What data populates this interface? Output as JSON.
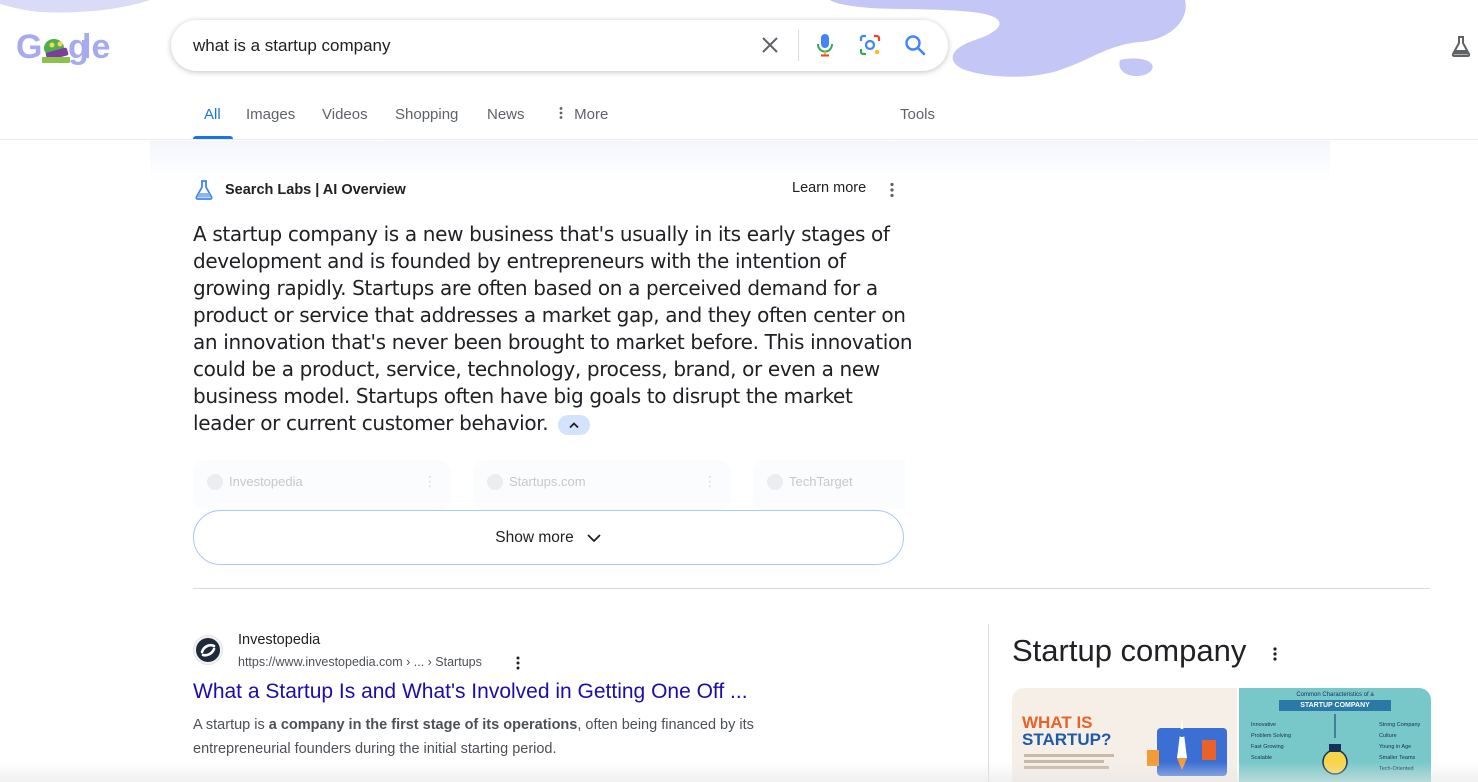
{
  "logo": {
    "text": "Google",
    "icon": "google-doodle-logo"
  },
  "search": {
    "query": "what is a startup company",
    "clear_icon": "close-icon",
    "voice_icon": "microphone-icon",
    "lens_icon": "camera-lens-icon",
    "search_icon": "search-icon"
  },
  "header": {
    "labs_icon": "flask-icon"
  },
  "nav": {
    "tabs": [
      {
        "label": "All",
        "active": true
      },
      {
        "label": "Images"
      },
      {
        "label": "Videos"
      },
      {
        "label": "Shopping"
      },
      {
        "label": "News"
      },
      {
        "label": "More"
      }
    ],
    "tools": "Tools"
  },
  "ai_overview": {
    "title": "Search Labs | AI Overview",
    "learn_more": "Learn more",
    "text": "A startup company is a new business that's usually in its early stages of development and is founded by entrepreneurs with the intention of growing rapidly. Startups are often based on a perceived demand for a product or service that addresses a market gap, and they often center on an innovation that's never been brought to market before. This innovation could be a product, service, technology, process, brand, or even a new business model. Startups often have big goals to disrupt the market leader or current customer behavior.",
    "sources": [
      "Investopedia",
      "Startups.com",
      "TechTarget"
    ],
    "show_more": "Show more"
  },
  "result": {
    "site_name": "Investopedia",
    "url": "https://www.investopedia.com › ... › Startups",
    "title": "What a Startup Is and What's Involved in Getting One Off ...",
    "snippet_pre": "A startup is ",
    "snippet_bold": "a company in the first stage of its operations",
    "snippet_post": ", often being financed by its entrepreneurial founders during the initial starting period."
  },
  "knowledge_panel": {
    "title": "Startup company",
    "image1_title_line1": "WHAT IS",
    "image1_title_line2": "STARTUP?",
    "image2_heading": "Common Characteristics of a",
    "image2_band": "STARTUP COMPANY",
    "image2_left": [
      "Innovative",
      "Problem Solving",
      "Fast Growing",
      "Scalable"
    ],
    "image2_right": [
      "Strong Company",
      "Culture",
      "Young in Age",
      "Smaller Teams",
      "Tech-Oriented"
    ]
  },
  "colors": {
    "accent": "#1a73e8",
    "link": "#1a0dab",
    "doodle": "#b9bdf0"
  }
}
